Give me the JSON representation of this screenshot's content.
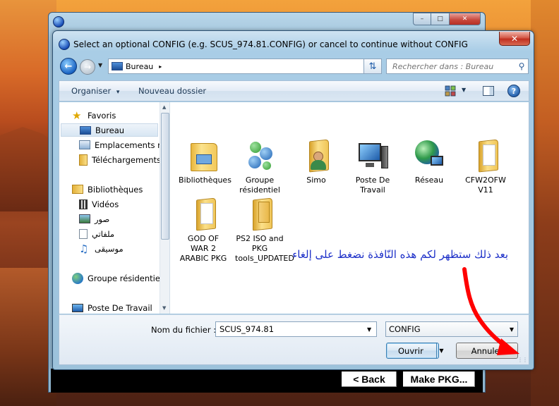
{
  "background_window": {
    "buttons": {
      "minimize": "–",
      "maximize": "□",
      "close": "✕",
      "back": "< Back",
      "make_pkg": "Make PKG..."
    }
  },
  "dialog": {
    "title": "Select an optional CONFIG (e.g. SCUS_974.81.CONFIG) or cancel to continue without CONFIG",
    "close_glyph": "✕",
    "address": {
      "location": "Bureau",
      "arrow": "▸"
    },
    "search": {
      "placeholder": "Rechercher dans : Bureau"
    },
    "toolbar": {
      "organize": "Organiser",
      "organize_arrow": "▾",
      "new_folder": "Nouveau dossier",
      "help": "?"
    },
    "nav": {
      "items": [
        {
          "label": "Favoris",
          "icon": "star-icon"
        },
        {
          "label": "Bureau",
          "icon": "desktop-icon"
        },
        {
          "label": "Emplacements ré",
          "icon": "recent-places-icon"
        },
        {
          "label": "Téléchargements",
          "icon": "downloads-icon"
        },
        {
          "label": "Bibliothèques",
          "icon": "libraries-icon"
        },
        {
          "label": "Vidéos",
          "icon": "videos-icon"
        },
        {
          "label": "صور",
          "icon": "pictures-icon"
        },
        {
          "label": "ملفاتي",
          "icon": "documents-icon"
        },
        {
          "label": "موسيقى",
          "icon": "music-icon"
        },
        {
          "label": "Groupe résidentiel",
          "icon": "homegroup-icon"
        },
        {
          "label": "Poste De Travail",
          "icon": "computer-icon"
        }
      ]
    },
    "files": [
      {
        "label": "Bibliothèques",
        "icon": "libraries-folder-icon"
      },
      {
        "label": "Groupe résidentiel",
        "icon": "homegroup-icon"
      },
      {
        "label": "Simo",
        "icon": "user-folder-icon"
      },
      {
        "label": "Poste De Travail",
        "icon": "computer-icon"
      },
      {
        "label": "Réseau",
        "icon": "network-icon"
      },
      {
        "label": "CFW2OFW V11",
        "icon": "folder-icon"
      },
      {
        "label": "GOD OF WAR 2 ARABIC PKG",
        "icon": "folder-icon"
      },
      {
        "label": "PS2 ISO and PKG tools_UPDATED",
        "icon": "folder-icon"
      }
    ],
    "filename": {
      "label": "Nom du fichier :",
      "value": "SCUS_974.81"
    },
    "filetype": {
      "value": "CONFIG"
    },
    "buttons": {
      "open": "Ouvrir",
      "cancel": "Annuler"
    }
  },
  "annotation": {
    "text": "بعد ذلك ستظهر لكم هذه النّافذة نضغط على إلغاء",
    "color": "#1c2fc8",
    "arrow_color": "#ff0000"
  }
}
